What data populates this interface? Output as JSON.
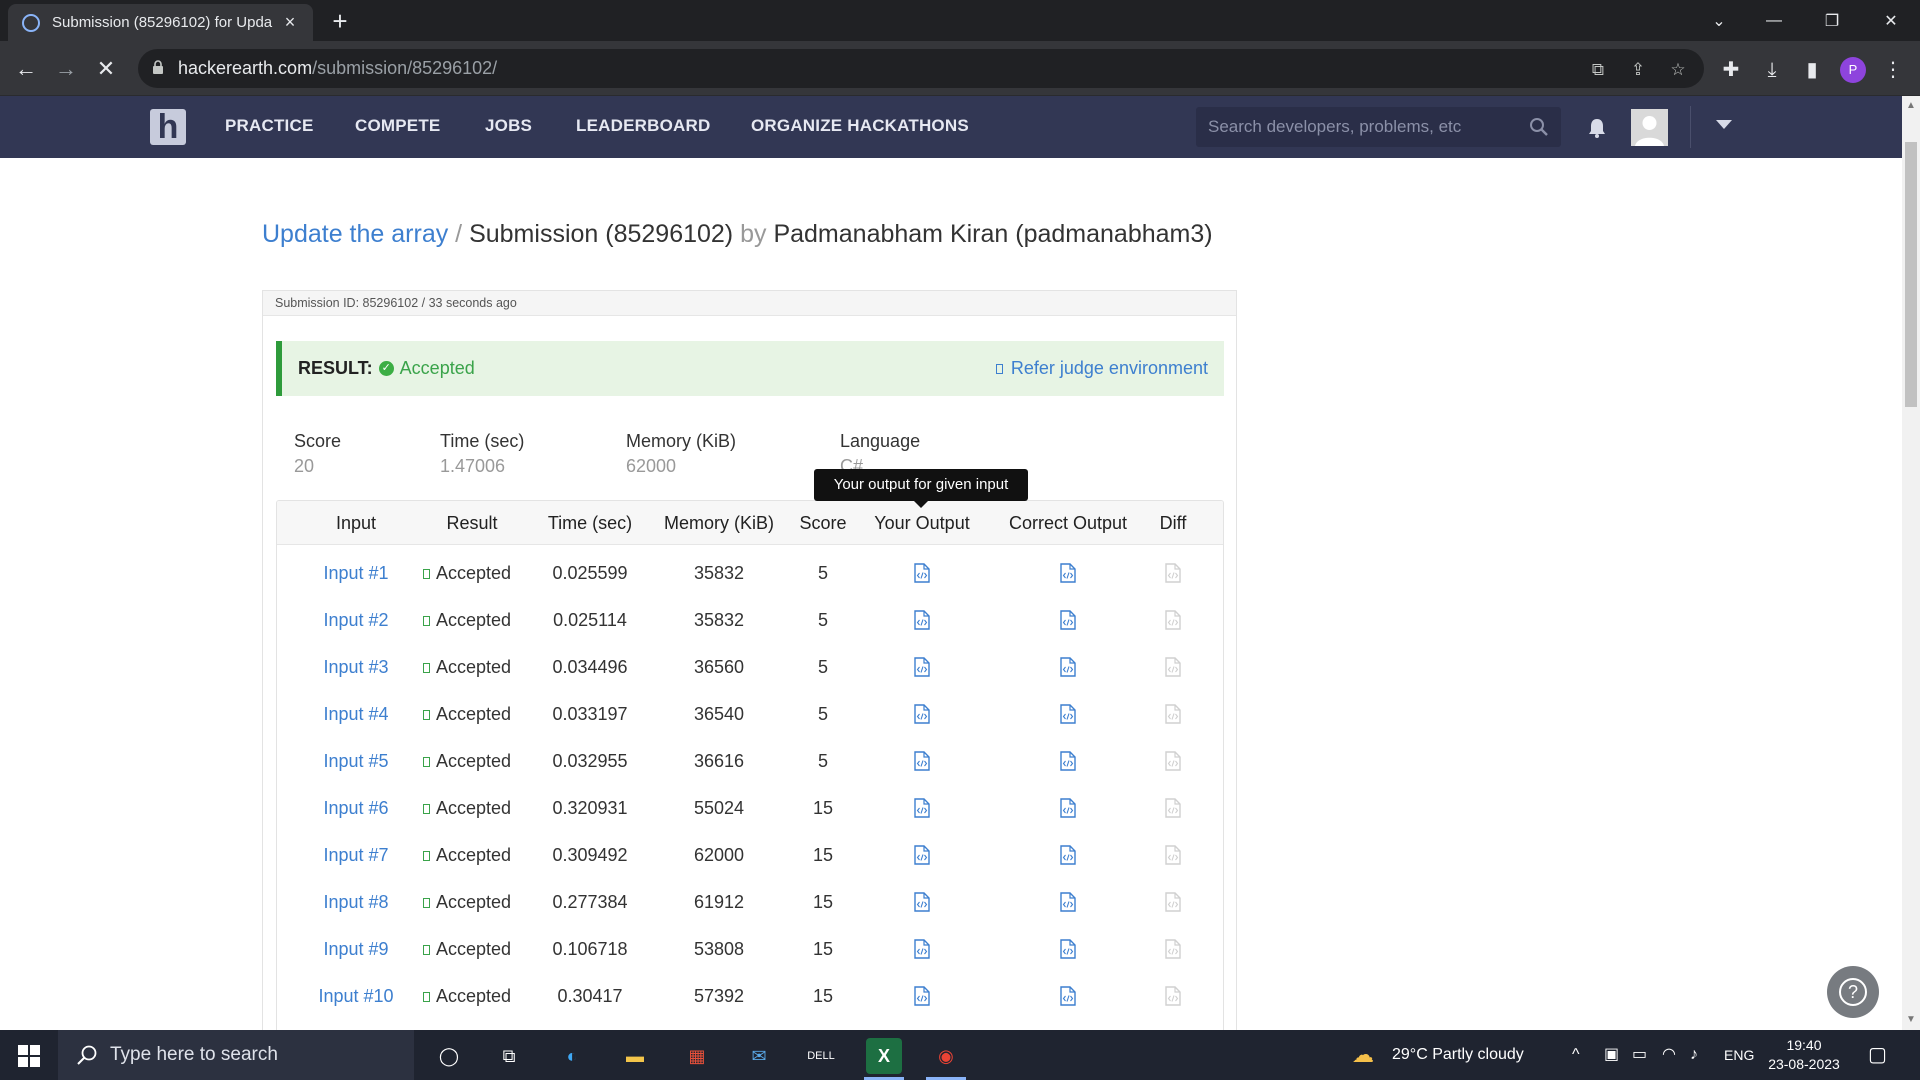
{
  "browser": {
    "tab_title": "Submission (85296102) for Upda",
    "url_host": "hackerearth.com",
    "url_path": "/submission/85296102/"
  },
  "nav": {
    "links": [
      "PRACTICE",
      "COMPETE",
      "JOBS",
      "LEADERBOARD",
      "ORGANIZE HACKATHONS"
    ],
    "search_placeholder": "Search developers, problems, etc"
  },
  "breadcrumb": {
    "problem": "Update the array",
    "separator": "/",
    "submission": "Submission (85296102)",
    "by": "by",
    "user": "Padmanabham Kiran (padmanabham3)"
  },
  "panel": {
    "header": "Submission ID: 85296102 / 33 seconds ago",
    "result_label": "RESULT:",
    "result_status": "Accepted",
    "refer_link": "Refer judge environment"
  },
  "stats": [
    {
      "label": "Score",
      "value": "20"
    },
    {
      "label": "Time (sec)",
      "value": "1.47006"
    },
    {
      "label": "Memory (KiB)",
      "value": "62000"
    },
    {
      "label": "Language",
      "value": "C#"
    }
  ],
  "tooltip": "Your output for given input",
  "table": {
    "headers": [
      "Input",
      "Result",
      "Time (sec)",
      "Memory (KiB)",
      "Score",
      "Your Output",
      "Correct Output",
      "Diff"
    ],
    "rows": [
      {
        "input": "Input #1",
        "result": "Accepted",
        "time": "0.025599",
        "memory": "35832",
        "score": "5"
      },
      {
        "input": "Input #2",
        "result": "Accepted",
        "time": "0.025114",
        "memory": "35832",
        "score": "5"
      },
      {
        "input": "Input #3",
        "result": "Accepted",
        "time": "0.034496",
        "memory": "36560",
        "score": "5"
      },
      {
        "input": "Input #4",
        "result": "Accepted",
        "time": "0.033197",
        "memory": "36540",
        "score": "5"
      },
      {
        "input": "Input #5",
        "result": "Accepted",
        "time": "0.032955",
        "memory": "36616",
        "score": "5"
      },
      {
        "input": "Input #6",
        "result": "Accepted",
        "time": "0.320931",
        "memory": "55024",
        "score": "15"
      },
      {
        "input": "Input #7",
        "result": "Accepted",
        "time": "0.309492",
        "memory": "62000",
        "score": "15"
      },
      {
        "input": "Input #8",
        "result": "Accepted",
        "time": "0.277384",
        "memory": "61912",
        "score": "15"
      },
      {
        "input": "Input #9",
        "result": "Accepted",
        "time": "0.106718",
        "memory": "53808",
        "score": "15"
      },
      {
        "input": "Input #10",
        "result": "Accepted",
        "time": "0.30417",
        "memory": "57392",
        "score": "15"
      }
    ]
  },
  "taskbar": {
    "search_placeholder": "Type here to search",
    "weather": "29°C  Partly cloudy",
    "lang": "ENG",
    "time": "19:40",
    "date": "23-08-2023"
  },
  "colors": {
    "nav_bg": "#323754",
    "link": "#3d7fcf",
    "accepted": "#3aa34a",
    "result_bg": "#e7f4e4"
  }
}
